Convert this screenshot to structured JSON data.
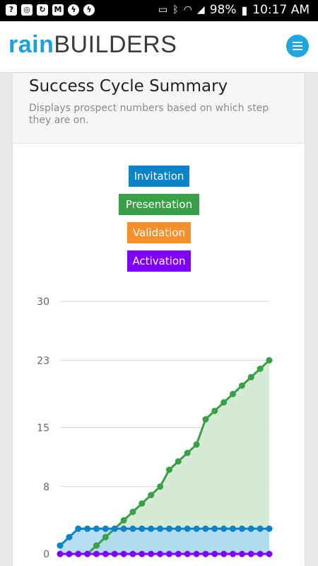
{
  "status": {
    "battery": "98%",
    "time": "10:17 AM"
  },
  "header": {
    "logo_rain": "rain",
    "logo_builders": "BUILDERS"
  },
  "card": {
    "title": "Success Cycle Summary",
    "subtitle": "Displays prospect numbers based on which step they are on."
  },
  "legend": [
    {
      "label": "Invitation",
      "color": "#0a83c9"
    },
    {
      "label": "Presentation",
      "color": "#3aa047"
    },
    {
      "label": "Validation",
      "color": "#f7902a"
    },
    {
      "label": "Activation",
      "color": "#8000ff"
    }
  ],
  "chart_data": {
    "type": "line",
    "y_ticks": [
      "30",
      "23",
      "15",
      "8",
      "0"
    ],
    "ylim": [
      0,
      30
    ],
    "series": [
      {
        "name": "Presentation",
        "color": "#3aa047",
        "fill": "#cfe8cf",
        "values": [
          0,
          0,
          0,
          0,
          1,
          2,
          3,
          4,
          5,
          6,
          7,
          8,
          10,
          11,
          12,
          13,
          16,
          17,
          18,
          19,
          20,
          21,
          22,
          23
        ]
      },
      {
        "name": "Invitation",
        "color": "#0a83c9",
        "fill": "#a9d9ee",
        "values": [
          1,
          2,
          3,
          3,
          3,
          3,
          3,
          3,
          3,
          3,
          3,
          3,
          3,
          3,
          3,
          3,
          3,
          3,
          3,
          3,
          3,
          3,
          3,
          3
        ]
      },
      {
        "name": "Activation",
        "color": "#8000ff",
        "fill": "none",
        "values": [
          0,
          0,
          0,
          0,
          0,
          0,
          0,
          0,
          0,
          0,
          0,
          0,
          0,
          0,
          0,
          0,
          0,
          0,
          0,
          0,
          0,
          0,
          0,
          0
        ]
      }
    ]
  }
}
